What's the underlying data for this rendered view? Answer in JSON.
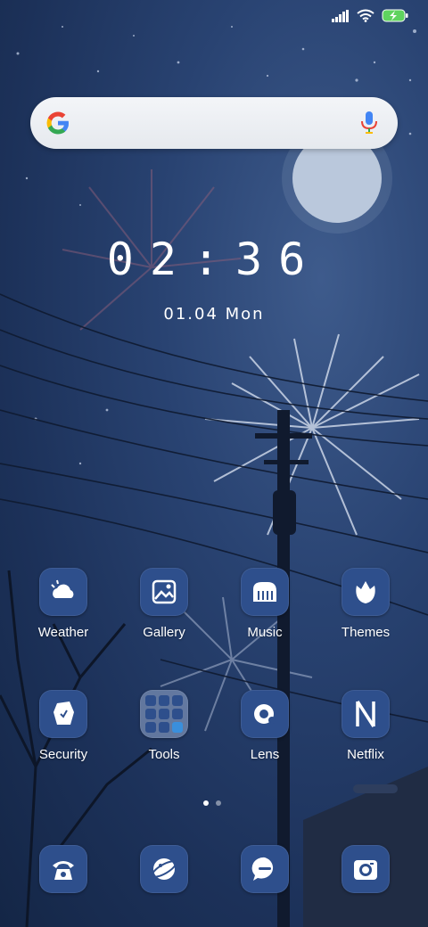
{
  "status": {
    "signal_icon": "signal-icon",
    "wifi_icon": "wifi-icon",
    "battery_icon": "battery-charging-icon",
    "battery_color": "#5fd35f"
  },
  "search": {
    "logo": "google-logo-icon",
    "mic": "mic-icon"
  },
  "clock": {
    "time": "02:36",
    "date": "01.04 Mon"
  },
  "apps_row1": [
    {
      "label": "Weather",
      "icon": "weather-icon"
    },
    {
      "label": "Gallery",
      "icon": "gallery-icon"
    },
    {
      "label": "Music",
      "icon": "music-icon"
    },
    {
      "label": "Themes",
      "icon": "themes-icon"
    }
  ],
  "apps_row2": [
    {
      "label": "Security",
      "icon": "security-icon"
    },
    {
      "label": "Tools",
      "icon": "folder-icon"
    },
    {
      "label": "Lens",
      "icon": "lens-icon"
    },
    {
      "label": "Netflix",
      "icon": "netflix-icon"
    }
  ],
  "dock": [
    {
      "icon": "phone-icon"
    },
    {
      "icon": "browser-icon"
    },
    {
      "icon": "messages-icon"
    },
    {
      "icon": "camera-icon"
    }
  ],
  "page_indicator": {
    "pages": 2,
    "current": 1
  },
  "colors": {
    "tile": "#2e4f8c",
    "icon_fg": "#ffffff"
  }
}
